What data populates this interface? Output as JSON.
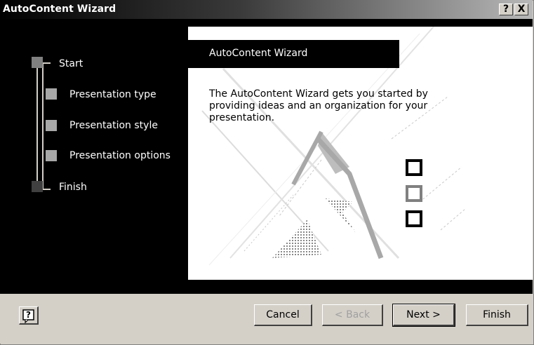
{
  "window": {
    "title": "AutoContent Wizard",
    "help_glyph": "?",
    "close_glyph": "X"
  },
  "steps": [
    {
      "label": "Start",
      "state": "visited"
    },
    {
      "label": "Presentation type",
      "state": "pending"
    },
    {
      "label": "Presentation style",
      "state": "pending"
    },
    {
      "label": "Presentation options",
      "state": "pending"
    },
    {
      "label": "Finish",
      "state": "current"
    }
  ],
  "panel": {
    "heading": "AutoContent Wizard",
    "description": "The AutoContent Wizard gets you started by providing ideas and an organization for your presentation."
  },
  "buttons": {
    "cancel": "Cancel",
    "back": "< Back",
    "next": "Next >",
    "finish": "Finish"
  },
  "colors": {
    "dialog_face": "#d4d0c8",
    "sidebar": "#000000",
    "step_visited": "#808080",
    "step_pending": "#a8a8a8",
    "step_current": "#404040"
  }
}
